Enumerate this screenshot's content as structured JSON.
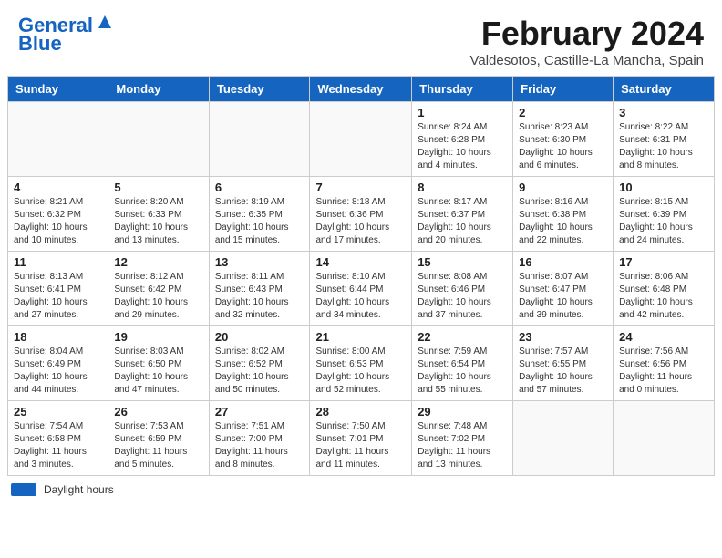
{
  "header": {
    "logo_line1": "General",
    "logo_line2": "Blue",
    "month": "February 2024",
    "location": "Valdesotos, Castille-La Mancha, Spain"
  },
  "weekdays": [
    "Sunday",
    "Monday",
    "Tuesday",
    "Wednesday",
    "Thursday",
    "Friday",
    "Saturday"
  ],
  "weeks": [
    [
      {
        "day": "",
        "info": ""
      },
      {
        "day": "",
        "info": ""
      },
      {
        "day": "",
        "info": ""
      },
      {
        "day": "",
        "info": ""
      },
      {
        "day": "1",
        "info": "Sunrise: 8:24 AM\nSunset: 6:28 PM\nDaylight: 10 hours\nand 4 minutes."
      },
      {
        "day": "2",
        "info": "Sunrise: 8:23 AM\nSunset: 6:30 PM\nDaylight: 10 hours\nand 6 minutes."
      },
      {
        "day": "3",
        "info": "Sunrise: 8:22 AM\nSunset: 6:31 PM\nDaylight: 10 hours\nand 8 minutes."
      }
    ],
    [
      {
        "day": "4",
        "info": "Sunrise: 8:21 AM\nSunset: 6:32 PM\nDaylight: 10 hours\nand 10 minutes."
      },
      {
        "day": "5",
        "info": "Sunrise: 8:20 AM\nSunset: 6:33 PM\nDaylight: 10 hours\nand 13 minutes."
      },
      {
        "day": "6",
        "info": "Sunrise: 8:19 AM\nSunset: 6:35 PM\nDaylight: 10 hours\nand 15 minutes."
      },
      {
        "day": "7",
        "info": "Sunrise: 8:18 AM\nSunset: 6:36 PM\nDaylight: 10 hours\nand 17 minutes."
      },
      {
        "day": "8",
        "info": "Sunrise: 8:17 AM\nSunset: 6:37 PM\nDaylight: 10 hours\nand 20 minutes."
      },
      {
        "day": "9",
        "info": "Sunrise: 8:16 AM\nSunset: 6:38 PM\nDaylight: 10 hours\nand 22 minutes."
      },
      {
        "day": "10",
        "info": "Sunrise: 8:15 AM\nSunset: 6:39 PM\nDaylight: 10 hours\nand 24 minutes."
      }
    ],
    [
      {
        "day": "11",
        "info": "Sunrise: 8:13 AM\nSunset: 6:41 PM\nDaylight: 10 hours\nand 27 minutes."
      },
      {
        "day": "12",
        "info": "Sunrise: 8:12 AM\nSunset: 6:42 PM\nDaylight: 10 hours\nand 29 minutes."
      },
      {
        "day": "13",
        "info": "Sunrise: 8:11 AM\nSunset: 6:43 PM\nDaylight: 10 hours\nand 32 minutes."
      },
      {
        "day": "14",
        "info": "Sunrise: 8:10 AM\nSunset: 6:44 PM\nDaylight: 10 hours\nand 34 minutes."
      },
      {
        "day": "15",
        "info": "Sunrise: 8:08 AM\nSunset: 6:46 PM\nDaylight: 10 hours\nand 37 minutes."
      },
      {
        "day": "16",
        "info": "Sunrise: 8:07 AM\nSunset: 6:47 PM\nDaylight: 10 hours\nand 39 minutes."
      },
      {
        "day": "17",
        "info": "Sunrise: 8:06 AM\nSunset: 6:48 PM\nDaylight: 10 hours\nand 42 minutes."
      }
    ],
    [
      {
        "day": "18",
        "info": "Sunrise: 8:04 AM\nSunset: 6:49 PM\nDaylight: 10 hours\nand 44 minutes."
      },
      {
        "day": "19",
        "info": "Sunrise: 8:03 AM\nSunset: 6:50 PM\nDaylight: 10 hours\nand 47 minutes."
      },
      {
        "day": "20",
        "info": "Sunrise: 8:02 AM\nSunset: 6:52 PM\nDaylight: 10 hours\nand 50 minutes."
      },
      {
        "day": "21",
        "info": "Sunrise: 8:00 AM\nSunset: 6:53 PM\nDaylight: 10 hours\nand 52 minutes."
      },
      {
        "day": "22",
        "info": "Sunrise: 7:59 AM\nSunset: 6:54 PM\nDaylight: 10 hours\nand 55 minutes."
      },
      {
        "day": "23",
        "info": "Sunrise: 7:57 AM\nSunset: 6:55 PM\nDaylight: 10 hours\nand 57 minutes."
      },
      {
        "day": "24",
        "info": "Sunrise: 7:56 AM\nSunset: 6:56 PM\nDaylight: 11 hours\nand 0 minutes."
      }
    ],
    [
      {
        "day": "25",
        "info": "Sunrise: 7:54 AM\nSunset: 6:58 PM\nDaylight: 11 hours\nand 3 minutes."
      },
      {
        "day": "26",
        "info": "Sunrise: 7:53 AM\nSunset: 6:59 PM\nDaylight: 11 hours\nand 5 minutes."
      },
      {
        "day": "27",
        "info": "Sunrise: 7:51 AM\nSunset: 7:00 PM\nDaylight: 11 hours\nand 8 minutes."
      },
      {
        "day": "28",
        "info": "Sunrise: 7:50 AM\nSunset: 7:01 PM\nDaylight: 11 hours\nand 11 minutes."
      },
      {
        "day": "29",
        "info": "Sunrise: 7:48 AM\nSunset: 7:02 PM\nDaylight: 11 hours\nand 13 minutes."
      },
      {
        "day": "",
        "info": ""
      },
      {
        "day": "",
        "info": ""
      }
    ]
  ],
  "legend": {
    "daylight_label": "Daylight hours"
  }
}
